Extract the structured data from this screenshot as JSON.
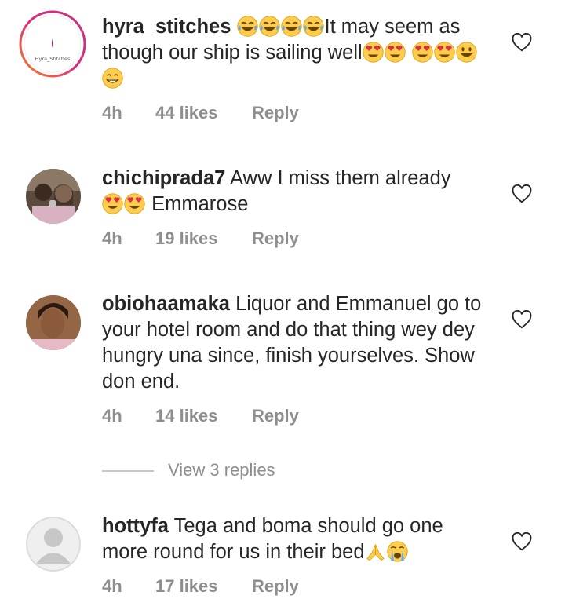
{
  "comments": [
    {
      "username": "hyra_stitches",
      "avatar_text": "Hyra_Stitches",
      "text_before": "It may seem as though our ship is sailing well",
      "emojis_before": [
        "joy-emoji",
        "joy-emoji",
        "joy-emoji",
        "joy-emoji"
      ],
      "emojis_after": [
        "heart-eyes-emoji",
        "heart-eyes-emoji",
        "heart-eyes-emoji",
        "heart-eyes-emoji",
        "smiley-emoji",
        "grin-emoji"
      ],
      "time": "4h",
      "likes": "44 likes",
      "reply_label": "Reply"
    },
    {
      "username": "chichiprada7",
      "text": "Aww I miss them already",
      "text_after_emojis": "Emmarose",
      "emojis": [
        "heart-eyes-emoji",
        "heart-eyes-emoji"
      ],
      "time": "4h",
      "likes": "19 likes",
      "reply_label": "Reply"
    },
    {
      "username": "obiohaamaka",
      "text": "Liquor and Emmanuel go to your hotel room and do that thing wey dey hungry una since, finish yourselves. Show don end.",
      "time": "4h",
      "likes": "14 likes",
      "reply_label": "Reply",
      "view_replies": "View 3 replies"
    },
    {
      "username": "hottyfa",
      "text": "Tega and boma should go one more round for us in their bed",
      "emojis": [
        "pray-emoji",
        "loudly-crying-emoji"
      ],
      "time": "4h",
      "likes": "17 likes",
      "reply_label": "Reply"
    }
  ],
  "colors": {
    "text": "#262626",
    "muted": "#8e8e8e",
    "story_ring_start": "#f58529",
    "story_ring_end": "#dd2a7b",
    "emoji": "#ffcc4d"
  }
}
